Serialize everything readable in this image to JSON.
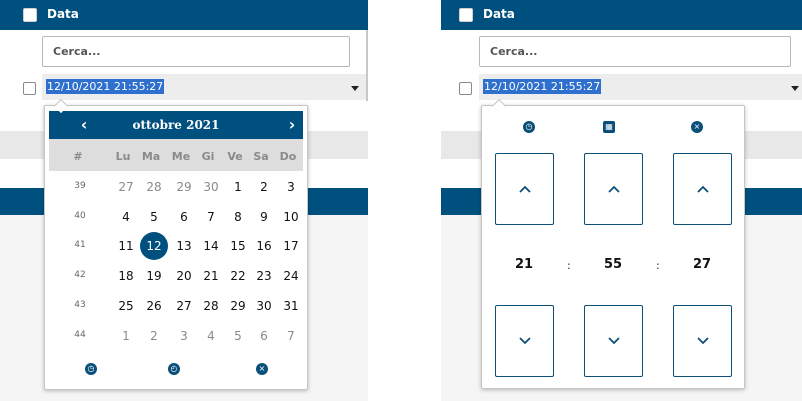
{
  "column": {
    "title": "Data"
  },
  "filter": {
    "placeholder": "Cerca..."
  },
  "field": {
    "value": "12/10/2021 21:55:27"
  },
  "calendar": {
    "month_label": "ottobre 2021",
    "prev_icon": "chevron-left",
    "next_icon": "chevron-right",
    "week_header": "#",
    "days_of_week": [
      "Lu",
      "Ma",
      "Me",
      "Gi",
      "Ve",
      "Sa",
      "Do"
    ],
    "weeks": [
      {
        "num": "39",
        "days": [
          "27",
          "28",
          "29",
          "30",
          "1",
          "2",
          "3"
        ],
        "muted": [
          true,
          true,
          true,
          true,
          false,
          false,
          false
        ]
      },
      {
        "num": "40",
        "days": [
          "4",
          "5",
          "6",
          "7",
          "8",
          "9",
          "10"
        ],
        "muted": [
          false,
          false,
          false,
          false,
          false,
          false,
          false
        ]
      },
      {
        "num": "41",
        "days": [
          "11",
          "12",
          "13",
          "14",
          "15",
          "16",
          "17"
        ],
        "muted": [
          false,
          false,
          false,
          false,
          false,
          false,
          false
        ]
      },
      {
        "num": "42",
        "days": [
          "18",
          "19",
          "20",
          "21",
          "22",
          "23",
          "24"
        ],
        "muted": [
          false,
          false,
          false,
          false,
          false,
          false,
          false
        ]
      },
      {
        "num": "43",
        "days": [
          "25",
          "26",
          "27",
          "28",
          "29",
          "30",
          "31"
        ],
        "muted": [
          false,
          false,
          false,
          false,
          false,
          false,
          false
        ]
      },
      {
        "num": "44",
        "days": [
          "1",
          "2",
          "3",
          "4",
          "5",
          "6",
          "7"
        ],
        "muted": [
          true,
          true,
          true,
          true,
          true,
          true,
          true
        ]
      }
    ],
    "selected_day": "12",
    "footer_icons": [
      "stopwatch-icon",
      "clock-icon",
      "clear-icon"
    ]
  },
  "time_picker": {
    "top_icons": [
      "stopwatch-icon",
      "calendar-icon",
      "clear-icon"
    ],
    "hours": "21",
    "minutes": "55",
    "seconds": "27",
    "separator": ":"
  },
  "colors": {
    "primary": "#00507f",
    "selection": "#2f6fce",
    "muted": "#8a8a8a"
  }
}
